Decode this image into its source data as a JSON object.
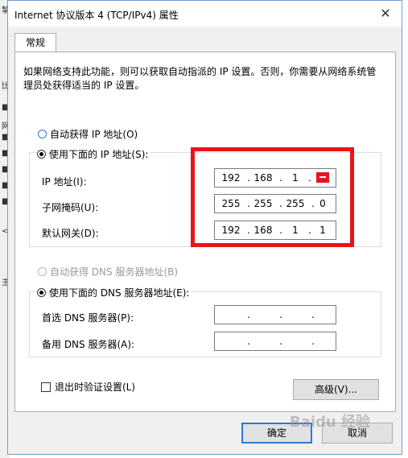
{
  "window": {
    "title": "Internet 协议版本 4 (TCP/IPv4) 属性",
    "close_glyph": "✕"
  },
  "tabs": [
    {
      "label": "常规",
      "selected": true
    }
  ],
  "description": "如果网络支持此功能，则可以获取自动指派的 IP 设置。否则，你需要从网络系统管理员处获得适当的 IP 设置。",
  "ip": {
    "auto_label": "自动获得 IP 地址(O)",
    "manual_label": "使用下面的 IP 地址(S):",
    "address_label": "IP 地址(I):",
    "address": [
      "192",
      "168",
      "1",
      ""
    ],
    "subnet_label": "子网掩码(U):",
    "subnet": [
      "255",
      "255",
      "255",
      "0"
    ],
    "gateway_label": "默认网关(D):",
    "gateway": [
      "192",
      "168",
      "1",
      "1"
    ]
  },
  "dns": {
    "auto_label": "自动获得 DNS 服务器地址(B)",
    "manual_label": "使用下面的 DNS 服务器地址(E):",
    "preferred_label": "首选 DNS 服务器(P):",
    "alternate_label": "备用 DNS 服务器(A):"
  },
  "validate_label": "退出时验证设置(L)",
  "advanced_label": "高级(V)...",
  "ok_label": "确定",
  "cancel_label": "取消",
  "background": {
    "marks": [
      "挈",
      "比",
      "网",
      "■",
      "■",
      "■",
      "■",
      "■",
      "■",
      "<",
      "主"
    ]
  },
  "watermark": "Baidu 经验",
  "colors": {
    "highlight": "#e8141c",
    "accent": "#2b7bd6"
  }
}
